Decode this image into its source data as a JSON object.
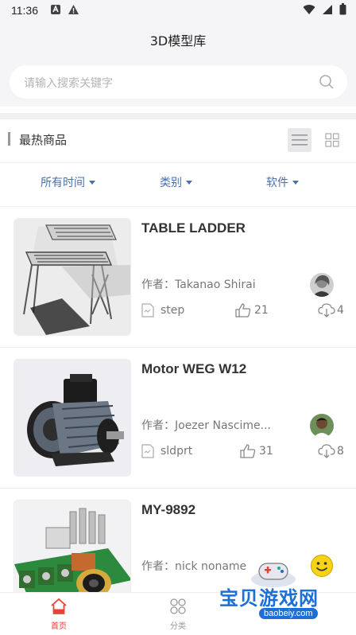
{
  "status_bar": {
    "time": "11:36"
  },
  "header": {
    "title": "3D模型库",
    "search_placeholder": "请输入搜索关键字"
  },
  "section": {
    "title": "最热商品"
  },
  "filters": [
    {
      "label": "所有时间"
    },
    {
      "label": "类别"
    },
    {
      "label": "软件"
    }
  ],
  "items": [
    {
      "title": "TABLE LADDER",
      "author": "作者：Takanao Shirai",
      "format": "step",
      "likes": "21",
      "downloads": "4"
    },
    {
      "title": "Motor WEG W12",
      "author": "作者：Joezer Nascime...",
      "format": "sldprt",
      "likes": "31",
      "downloads": "8"
    },
    {
      "title": "MY-9892",
      "author": "作者：nick noname",
      "format": "",
      "likes": "",
      "downloads": ""
    }
  ],
  "tabbar": {
    "tabs": [
      {
        "label": "首页",
        "active": true
      },
      {
        "label": "分类",
        "active": false
      }
    ]
  },
  "watermark": {
    "text": "宝贝游戏网",
    "url": "baobeiy.com"
  },
  "colors": {
    "accent": "#4a6fb0",
    "active_tab": "#e8433a",
    "header_bg": "#f5f5f7"
  }
}
